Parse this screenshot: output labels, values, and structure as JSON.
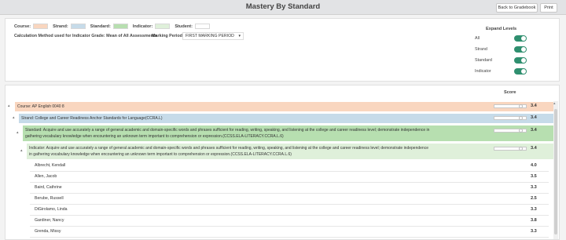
{
  "header": {
    "title": "Mastery By Standard",
    "back_label": "Back to Gradebook",
    "print_label": "Print"
  },
  "legend": {
    "course": {
      "label": "Course:",
      "color": "#f9d6bf"
    },
    "strand": {
      "label": "Strand:",
      "color": "#c6dbe9"
    },
    "standard": {
      "label": "Standard:",
      "color": "#b7dfb0"
    },
    "indicator": {
      "label": "Indicator:",
      "color": "#dff0da"
    },
    "student": {
      "label": "Student:",
      "color": "#ffffff"
    }
  },
  "calc_method": "Calculation Method used for Indicator Grade: Mean of All Assessments",
  "marking_period": {
    "label": "Marking Period:",
    "value": "FIRST MARKING PERIOD"
  },
  "expand_levels": {
    "title": "Expand Levels",
    "items": [
      {
        "label": "All",
        "on": true
      },
      {
        "label": "Strand",
        "on": true
      },
      {
        "label": "Standard",
        "on": true
      },
      {
        "label": "Indicator",
        "on": true
      }
    ]
  },
  "score_header": "Score",
  "tree": {
    "course": {
      "text": "Course: AP English 0040 8",
      "score": "3.4",
      "fraction": 0.85
    },
    "strand": {
      "text": "Strand: College and Career Readiness Anchor Standards for Language(CCRA.L)",
      "score": "3.4",
      "fraction": 0.85
    },
    "standard": {
      "line1": "Standard: Acquire and use accurately a range of general academic and domain-specific words and phrases sufficient for reading, writing, speaking, and listening at the college and career readiness level; demonstrate independence in",
      "line2": "gathering vocabulary knowledge when encountering an unknown term important to comprehension or expression.(CCSS.ELA-LITERACY.CCRA.L.6)",
      "score": "3.4",
      "fraction": 0.85
    },
    "indicator": {
      "line1": "Indicator: Acquire and use accurately a range of general academic and domain-specific words and phrases sufficient for reading, writing, speaking, and listening at the college and career readiness level; demonstrate independence",
      "line2": "in gathering vocabulary knowledge when encountering an unknown term important to comprehension or expression.(CCSS.ELA-LITERACY.CCRA.L.6)",
      "score": "3.4",
      "fraction": 0.85
    },
    "students": [
      {
        "name": "Albrecht, Kendall",
        "score": "4.0",
        "fraction": 1.0
      },
      {
        "name": "Allen, Jacob",
        "score": "3.5",
        "fraction": 0.875
      },
      {
        "name": "Baird, Cathrine",
        "score": "3.3",
        "fraction": 0.825
      },
      {
        "name": "Berube, Russell",
        "score": "2.5",
        "fraction": 0.625
      },
      {
        "name": "DiGirolamo, Linda",
        "score": "3.3",
        "fraction": 0.825
      },
      {
        "name": "Gardiner, Nancy",
        "score": "3.8",
        "fraction": 0.95
      },
      {
        "name": "Grenda, Missy",
        "score": "3.3",
        "fraction": 0.825
      }
    ]
  }
}
